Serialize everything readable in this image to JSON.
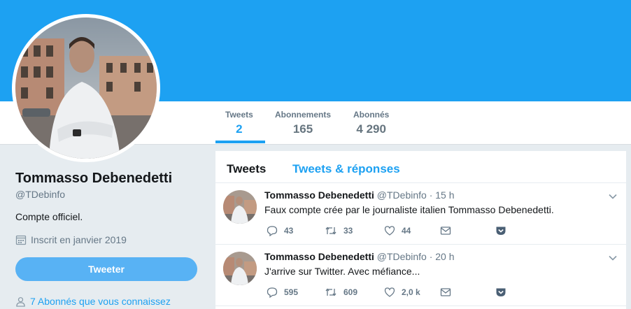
{
  "profile": {
    "name": "Tommasso Debenedetti",
    "handle": "@TDebinfo",
    "bio": "Compte officiel.",
    "joined": "Inscrit en janvier 2019",
    "tweet_button": "Tweeter",
    "followers_you_know": "7 Abonnés que vous connaissez"
  },
  "stats": [
    {
      "label": "Tweets",
      "value": "2"
    },
    {
      "label": "Abonnements",
      "value": "165"
    },
    {
      "label": "Abonnés",
      "value": "4 290"
    }
  ],
  "timeline_tabs": [
    "Tweets",
    "Tweets & réponses"
  ],
  "tweets": [
    {
      "name": "Tommasso Debenedetti",
      "handle": "@TDebinfo",
      "time": "· 15 h",
      "text": "Faux compte crée par le journaliste italien Tommasso Debenedetti.",
      "replies": "43",
      "retweets": "33",
      "likes": "44"
    },
    {
      "name": "Tommasso Debenedetti",
      "handle": "@TDebinfo",
      "time": "· 20 h",
      "text": "J'arrive sur Twitter. Avec méfiance...",
      "replies": "595",
      "retweets": "609",
      "likes": "2,0 k"
    }
  ],
  "icons": {
    "joined": "calendar-icon",
    "followers": "person-icon",
    "reply": "reply-icon",
    "retweet": "retweet-icon",
    "like": "heart-icon",
    "dm": "envelope-icon",
    "pocket": "pocket-icon",
    "caret": "chevron-down-icon"
  },
  "colors": {
    "banner": "#1da1f2",
    "accent": "#1da1f2",
    "tweet_button": "#58b2f4",
    "background": "#e6ecf0"
  }
}
